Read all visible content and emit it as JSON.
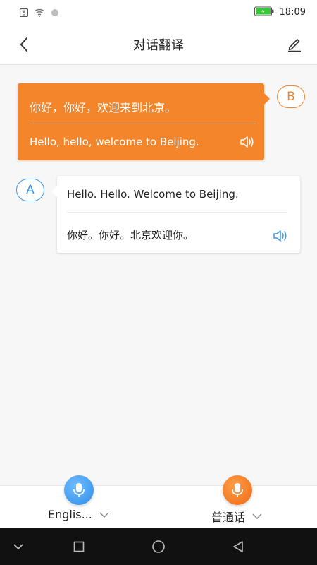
{
  "status_bar": {
    "time": "18:09",
    "icons": [
      "alert-icon",
      "wifi-icon",
      "dot-icon",
      "battery-icon"
    ]
  },
  "header": {
    "title": "对话翻译",
    "back_icon": "back-arrow-icon",
    "edit_icon": "edit-pen-icon"
  },
  "conversation": [
    {
      "speaker": "B",
      "source_text": "你好，你好，欢迎来到北京。",
      "translated_text": "Hello, hello, welcome to Beijing."
    },
    {
      "speaker": "A",
      "source_text": "Hello. Hello. Welcome to Beijing.",
      "translated_text": "你好。你好。北京欢迎你。"
    }
  ],
  "languages": {
    "left_label": "Englis...",
    "right_label": "普通话"
  },
  "colors": {
    "accent_orange": "#f5852b",
    "accent_blue": "#3c96e6",
    "nav_bar": "#111111"
  }
}
